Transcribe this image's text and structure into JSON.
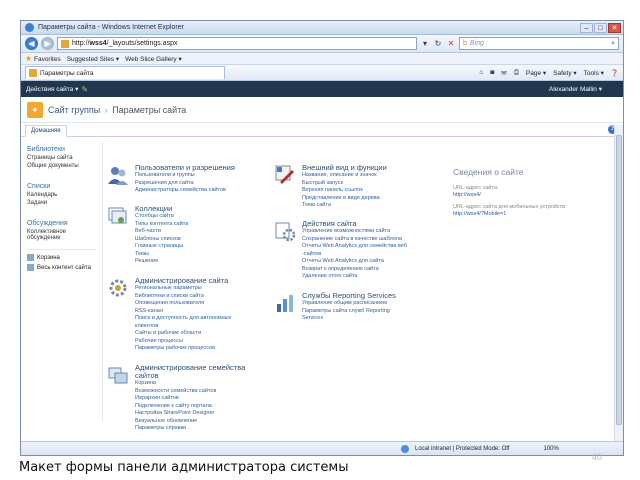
{
  "browser": {
    "window_title": "Параметры сайта - Windows Internet Explorer",
    "url_prefix": "http://",
    "url_host": "wss4",
    "url_path": "/_layouts/settings.aspx",
    "search_placeholder": "Bing",
    "favorites_label": "Favorites",
    "suggested_sites": "Suggested Sites ▾",
    "web_slice_gallery": "Web Slice Gallery ▾",
    "tab_title": "Параметры сайта",
    "commands": [
      "Page ▾",
      "Safety ▾",
      "Tools ▾"
    ],
    "status_zone": "Local intranet | Protected Mode: Off",
    "zoom": "100%"
  },
  "sharepoint": {
    "site_actions": "Действия сайта ▾",
    "user": "Alexander Mallin ▾",
    "site_title": "Сайт группы",
    "breadcrumb_sep": "›",
    "page_title": "Параметры сайта",
    "home_tab": "Домашняя",
    "help": "?"
  },
  "quick_launch": {
    "groups": [
      {
        "heading": "Библиотеки",
        "items": [
          "Страницы сайта",
          "Общие документы"
        ]
      },
      {
        "heading": "Списки",
        "items": [
          "Календарь",
          "Задачи"
        ]
      },
      {
        "heading": "Обсуждения",
        "items": [
          "Коллективное",
          "обсуждение"
        ]
      }
    ],
    "recycle_bin": "Корзина",
    "all_content": "Весь контент сайта"
  },
  "sections": {
    "users": {
      "title": "Пользователи и разрешения",
      "links": [
        "Пользователи и группы",
        "Разрешения для сайта",
        "Администраторы семейства сайтов"
      ]
    },
    "galleries": {
      "title": "Коллекции",
      "links": [
        "Столбцы сайта",
        "Типы контента сайта",
        "Веб-части",
        "Шаблоны списков",
        "Главные страницы",
        "Темы",
        "Решения"
      ]
    },
    "site_admin": {
      "title": "Администрирование сайта",
      "links": [
        "Региональные параметры",
        "Библиотеки и списки сайта",
        "Оповещения пользователя",
        "RSS-канал",
        "Поиск и доступность для автономных",
        "клиентов",
        "Сайты и рабочие области",
        "Рабочие процессы",
        "Параметры рабочих процессов"
      ]
    },
    "collection_admin": {
      "title_1": "Администрирование семейства",
      "title_2": "сайтов",
      "links": [
        "Корзина",
        "Возможности семейства сайтов",
        "Иерархия сайтов",
        "Подключение к сайту портала",
        "Настройка SharePoint Designer",
        "Визуальное обновление",
        "Параметры справки"
      ]
    },
    "look": {
      "title": "Внешний вид и функции",
      "links": [
        "Название, описание и значок",
        "Быстрый запуск",
        "Верхняя панель ссылок",
        "Представление в виде дерева",
        "Тема сайта"
      ]
    },
    "actions": {
      "title": "Действия сайта",
      "links": [
        "Управление возможностями сайта",
        "Сохранение сайта в качестве шаблона",
        "Отчеты Web Analytics для семейства веб",
        "-сайтов",
        "Отчеты Web Analytics для сайта",
        "Возврат к определению сайта",
        "Удаление этого сайта"
      ]
    },
    "reporting": {
      "title": "Службы Reporting Services",
      "links": [
        "Управление общим расписанием",
        "Параметры сайта служб Reporting",
        "Services"
      ]
    }
  },
  "site_info": {
    "title": "Сведения о сайте",
    "url_label": "URL-адрес сайта:",
    "url_value": "http://wss4/",
    "mobile_label": "URL-адрес сайта для мобильных устройств:",
    "mobile_value": "http://wss4/?Mobile=1"
  },
  "caption": "Макет формы панели администратора системы",
  "slide_number": "40"
}
